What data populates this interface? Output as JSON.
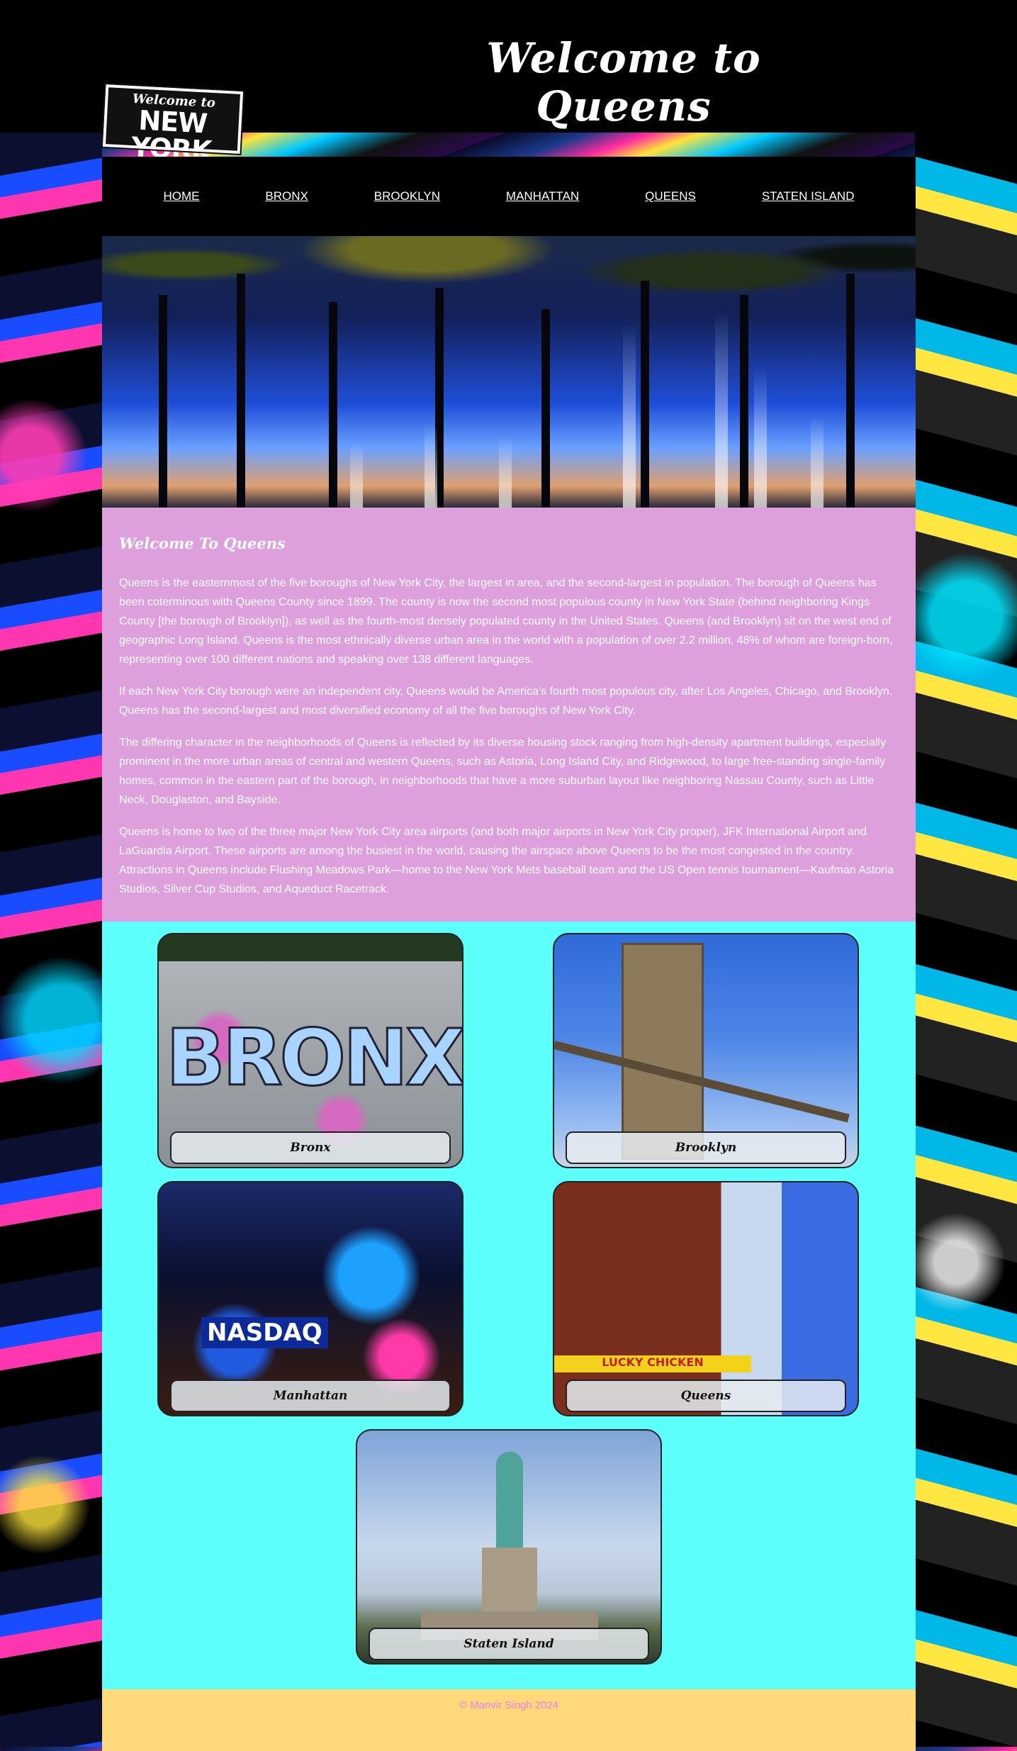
{
  "header": {
    "title": "Welcome to Queens",
    "logo_line1": "Welcome to",
    "logo_line2": "NEW YORK"
  },
  "nav": {
    "items": [
      {
        "label": "HOME"
      },
      {
        "label": "BRONX"
      },
      {
        "label": "BROOKLYN"
      },
      {
        "label": "MANHATTAN"
      },
      {
        "label": "QUEENS"
      },
      {
        "label": "STATEN ISLAND"
      }
    ]
  },
  "about": {
    "heading": "Welcome To Queens",
    "paragraphs": [
      "Queens is the easternmost of the five boroughs of New York City, the largest in area, and the second-largest in population. The borough of Queens has been coterminous with Queens County since 1899. The county is now the second most populous county in New York State (behind neighboring Kings County [the borough of Brooklyn]), as well as the fourth-most densely populated county in the United States. Queens (and Brooklyn) sit on the west end of geographic Long Island. Queens is the most ethnically diverse urban area in the world with a population of over 2.2 million, 48% of whom are foreign-born, representing over 100 different nations and speaking over 138 different languages.",
      "If each New York City borough were an independent city, Queens would be America's fourth most populous city, after Los Angeles, Chicago, and Brooklyn. Queens has the second-largest and most diversified economy of all the five boroughs of New York City.",
      "The differing character in the neighborhoods of Queens is reflected by its diverse housing stock ranging from high-density apartment buildings, especially prominent in the more urban areas of central and western Queens, such as Astoria, Long Island City, and Ridgewood, to large free-standing single-family homes, common in the eastern part of the borough, in neighborhoods that have a more suburban layout like neighboring Nassau County, such as Little Neck, Douglaston, and Bayside.",
      "Queens is home to two of the three major New York City area airports (and both major airports in New York City proper), JFK International Airport and LaGuardia Airport. These airports are among the busiest in the world, causing the airspace above Queens to be the most congested in the country. Attractions in Queens include Flushing Meadows Park—home to the New York Mets baseball team and the US Open tennis tournament—Kaufman Astoria Studios, Silver Cup Studios, and Aqueduct Racetrack."
    ]
  },
  "gallery": {
    "cards": [
      {
        "caption": "Bronx",
        "image_text": "BRONX"
      },
      {
        "caption": "Brooklyn"
      },
      {
        "caption": "Manhattan",
        "image_text": "NASDAQ"
      },
      {
        "caption": "Queens",
        "image_text": "LUCKY CHICKEN"
      },
      {
        "caption": "Staten Island"
      }
    ]
  },
  "footer": {
    "text": "© Manvir Singh 2024"
  },
  "colors": {
    "about_bg": "#dda0dd",
    "gallery_bg": "#5cfffa",
    "footer_bg": "#ffd97a",
    "footer_text": "#ee82ee"
  }
}
